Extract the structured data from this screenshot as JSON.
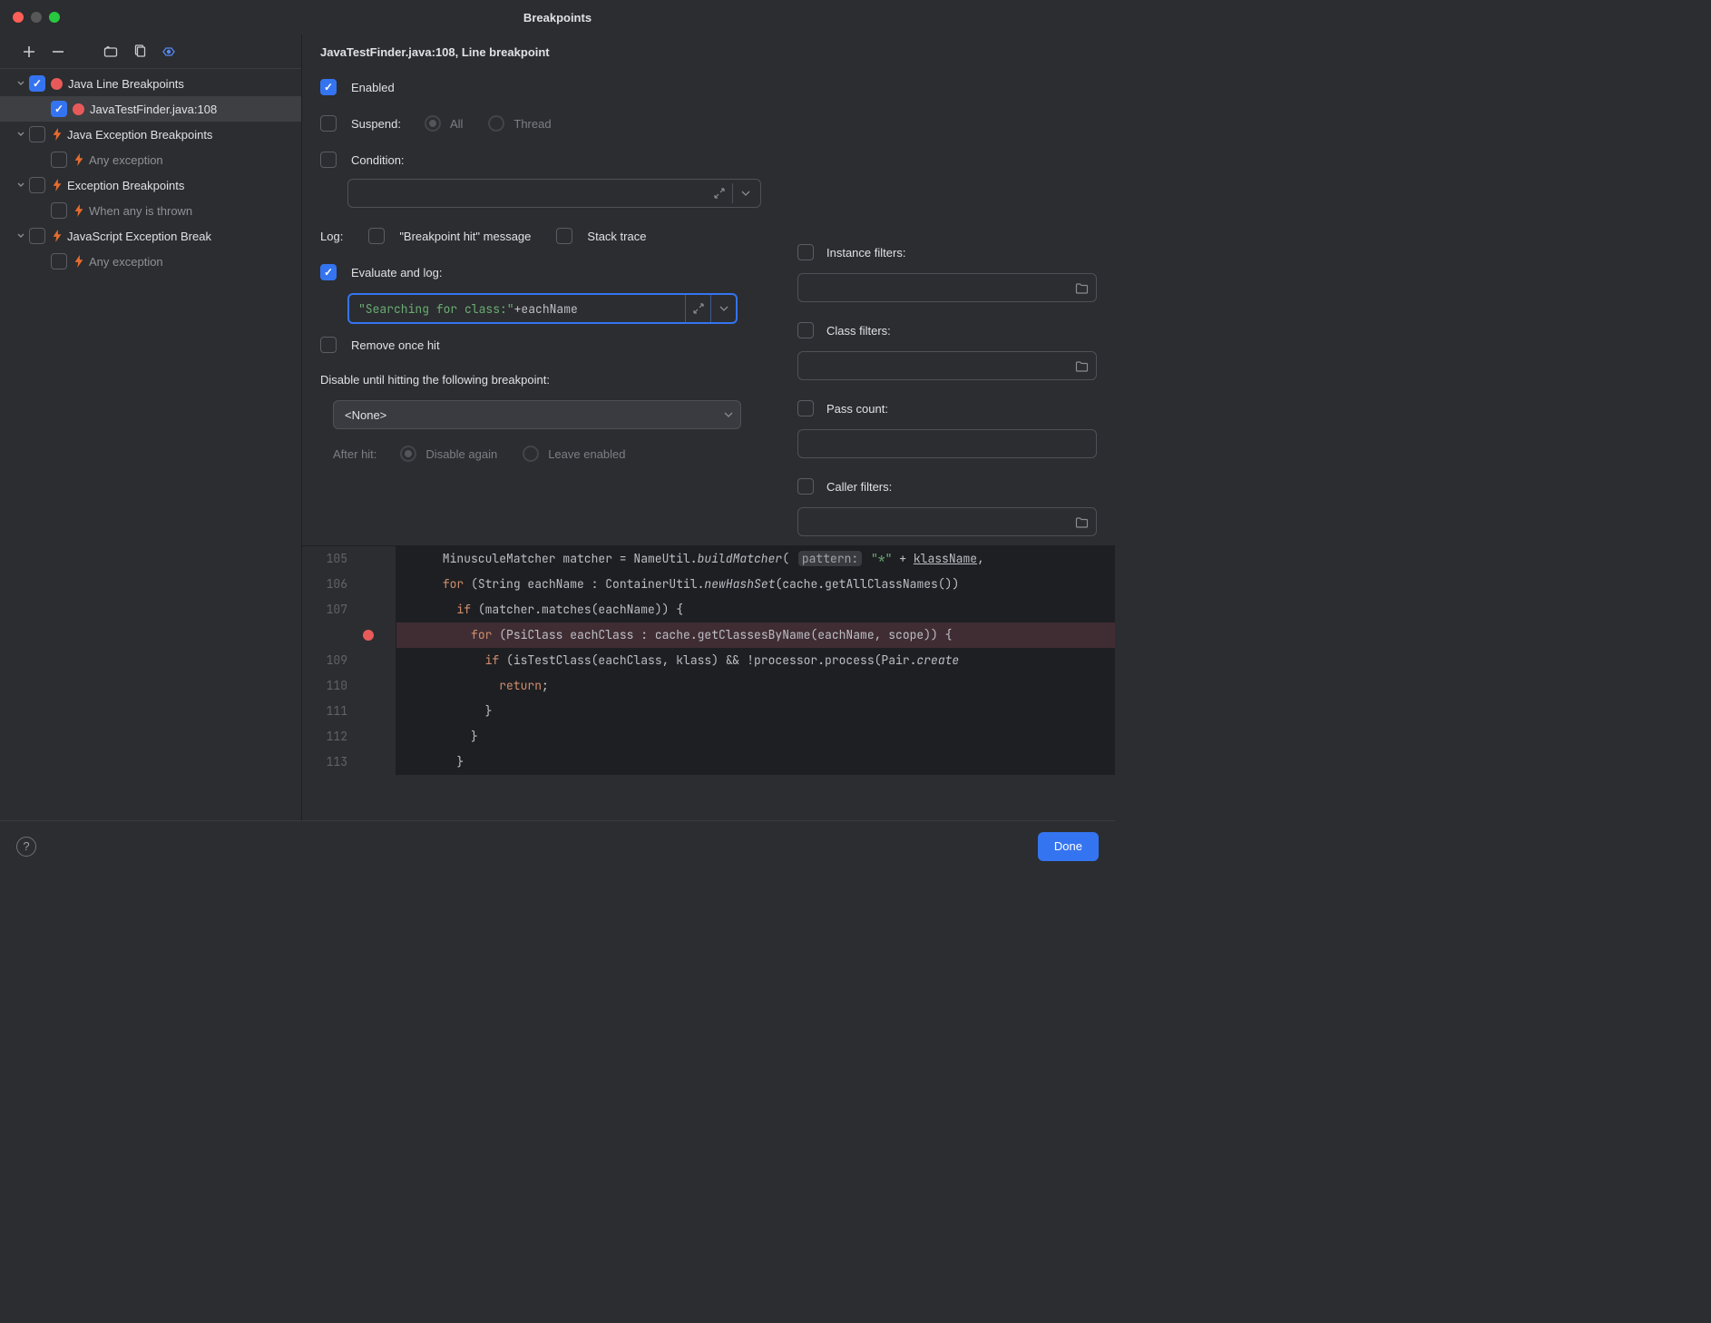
{
  "window": {
    "title": "Breakpoints"
  },
  "sidebar": {
    "groups": [
      {
        "label": "Java Line Breakpoints",
        "icon": "dot",
        "checked": true,
        "children": [
          {
            "label": "JavaTestFinder.java:108",
            "icon": "dot",
            "checked": true,
            "selected": true
          }
        ]
      },
      {
        "label": "Java Exception Breakpoints",
        "icon": "lightning",
        "checked": false,
        "children": [
          {
            "label": "Any exception",
            "icon": "lightning",
            "checked": false,
            "muted": true
          }
        ]
      },
      {
        "label": "Exception Breakpoints",
        "icon": "lightning",
        "checked": false,
        "children": [
          {
            "label": "When any is thrown",
            "icon": "lightning",
            "checked": false,
            "muted": true
          }
        ]
      },
      {
        "label": "JavaScript Exception Breakpoints",
        "icon": "lightning",
        "checked": false,
        "label_trunc": "JavaScript Exception Break",
        "children": [
          {
            "label": "Any exception",
            "icon": "lightning",
            "checked": false,
            "muted": true
          }
        ]
      }
    ]
  },
  "header": {
    "title": "JavaTestFinder.java:108, Line breakpoint"
  },
  "form": {
    "enabled_label": "Enabled",
    "suspend_label": "Suspend:",
    "suspend_all": "All",
    "suspend_thread": "Thread",
    "condition_label": "Condition:",
    "log_label": "Log:",
    "log_bp_hit": "\"Breakpoint hit\" message",
    "log_stack": "Stack trace",
    "eval_label": "Evaluate and log:",
    "eval_expr_str": "\"Searching for class:\"",
    "eval_expr_op": " + ",
    "eval_expr_ident": "eachName",
    "remove_label": "Remove once hit",
    "disable_until_label": "Disable until hitting the following breakpoint:",
    "disable_until_value": "<None>",
    "after_hit_label": "After hit:",
    "after_hit_disable": "Disable again",
    "after_hit_leave": "Leave enabled",
    "instance_filters": "Instance filters:",
    "class_filters": "Class filters:",
    "pass_count": "Pass count:",
    "caller_filters": "Caller filters:"
  },
  "code": {
    "lines": [
      {
        "n": "105",
        "html": "      MinusculeMatcher matcher = NameUtil.<span class='it'>buildMatcher</span>( <span class='param-hint'>pattern:</span> <span class='str2'>\"*\"</span> + <span class='ul'>klassName</span>,"
      },
      {
        "n": "106",
        "html": "      <span class='kw'>for</span> (String eachName : ContainerUtil.<span class='it'>newHashSet</span>(cache.getAllClassNames())"
      },
      {
        "n": "107",
        "html": "        <span class='kw'>if</span> (matcher.matches(eachName)) {"
      },
      {
        "n": "",
        "html": "          <span class='kw'>for</span> (PsiClass eachClass : cache.getClassesByName(eachName, scope)) {",
        "bp": true,
        "hl": true
      },
      {
        "n": "109",
        "html": "            <span class='kw'>if</span> (isTestClass(eachClass, klass) && !processor.process(Pair.<span class='it'>create</span>"
      },
      {
        "n": "110",
        "html": "              <span class='kw'>return</span>;"
      },
      {
        "n": "111",
        "html": "            }"
      },
      {
        "n": "112",
        "html": "          }"
      },
      {
        "n": "113",
        "html": "        }"
      }
    ]
  },
  "footer": {
    "done": "Done"
  }
}
